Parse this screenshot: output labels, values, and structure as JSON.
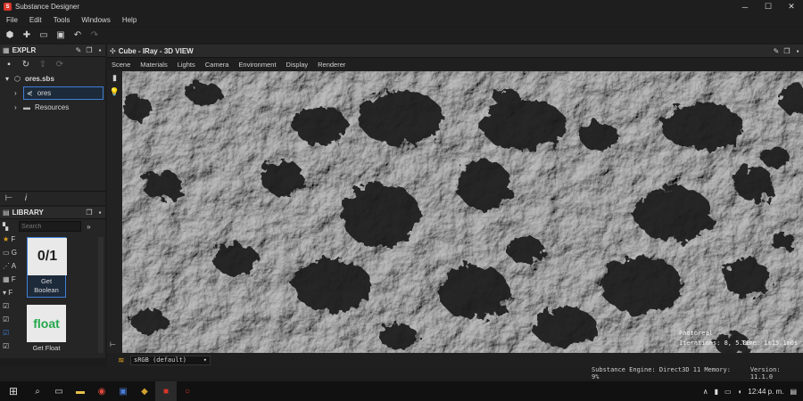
{
  "window": {
    "title": "Substance Designer",
    "controls": {
      "minimize": "─",
      "maximize": "☐",
      "close": "✕"
    }
  },
  "menu": [
    "File",
    "Edit",
    "Tools",
    "Windows",
    "Help"
  ],
  "explorer": {
    "title": "EXPLR",
    "package": "ores.sbs",
    "graph": "ores",
    "folder": "Resources"
  },
  "library": {
    "title": "LIBRARY",
    "search_placeholder": "Search",
    "left_letters": [
      "F",
      "G",
      "A",
      "F",
      "F"
    ],
    "items": [
      {
        "icon_text": "0/1",
        "label": "Get Boolean"
      },
      {
        "icon_text": "float",
        "label": "Get Float"
      }
    ]
  },
  "view3d": {
    "title": "Cube - IRay - 3D VIEW",
    "menu": [
      "Scene",
      "Materials",
      "Lights",
      "Camera",
      "Environment",
      "Display",
      "Renderer"
    ],
    "overlay_mode": "Photoreal",
    "overlay_iterations": "Iterations: 8, 5.00",
    "overlay_time": "Time: 1m15.1m0s",
    "colorspace": "sRGB (default)"
  },
  "status": {
    "engine": "Substance Engine: Direct3D 11  Memory: 9%",
    "version": "Version: 11.1.0"
  },
  "taskbar": {
    "time": "12:44 p. m."
  },
  "colors": {
    "accent": "#3f7fd6",
    "app_icon": "#d9352b",
    "float_green": "#23a84b"
  }
}
